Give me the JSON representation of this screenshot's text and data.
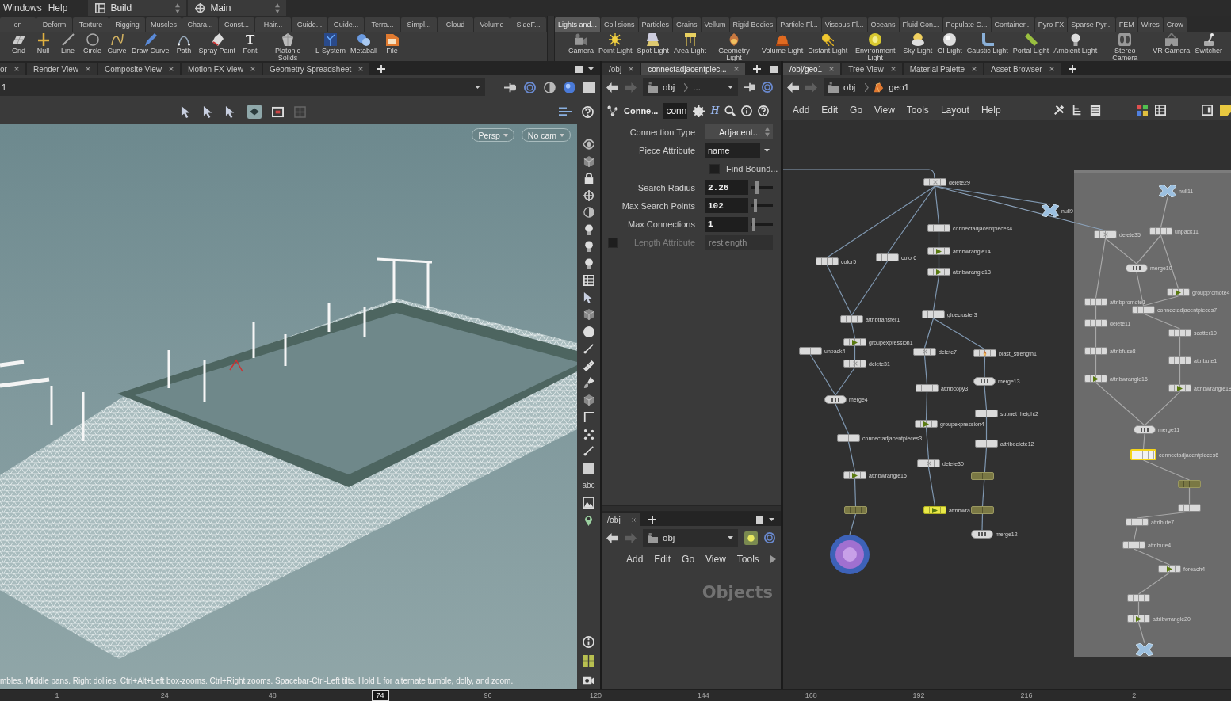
{
  "menubar": {
    "menus": [
      "Windows",
      "Help"
    ],
    "dropdowns": [
      "Build",
      "Main"
    ]
  },
  "shelves": [
    {
      "tabs": [
        {
          "label": "on",
          "selected": false
        },
        {
          "label": "Deform",
          "selected": false
        },
        {
          "label": "Texture",
          "selected": false
        },
        {
          "label": "Rigging",
          "selected": false
        },
        {
          "label": "Muscles",
          "selected": false
        },
        {
          "label": "Chara...",
          "selected": false
        },
        {
          "label": "Const...",
          "selected": false
        },
        {
          "label": "Hair...",
          "selected": false
        },
        {
          "label": "Guide...",
          "selected": false
        },
        {
          "label": "Guide...",
          "selected": false
        },
        {
          "label": "Terra...",
          "selected": false
        },
        {
          "label": "Simpl...",
          "selected": false
        },
        {
          "label": "Cloud",
          "selected": false
        },
        {
          "label": "Volume",
          "selected": false
        },
        {
          "label": "SideF...",
          "selected": false
        }
      ],
      "tools": [
        {
          "label": "Grid"
        },
        {
          "label": "Null"
        },
        {
          "label": "Line"
        },
        {
          "label": "Circle"
        },
        {
          "label": "Curve"
        },
        {
          "label": "Draw Curve"
        },
        {
          "label": "Path"
        },
        {
          "label": "Spray Paint"
        },
        {
          "label": "Font",
          "glyph": "T"
        },
        {
          "label": "Platonic Solids"
        },
        {
          "label": "L-System"
        },
        {
          "label": "Metaball"
        },
        {
          "label": "File"
        }
      ]
    },
    {
      "tabs": [
        {
          "label": "Lights and...",
          "selected": true
        },
        {
          "label": "Collisions",
          "selected": false
        },
        {
          "label": "Particles",
          "selected": false
        },
        {
          "label": "Grains",
          "selected": false
        },
        {
          "label": "Vellum",
          "selected": false
        },
        {
          "label": "Rigid Bodies",
          "selected": false
        },
        {
          "label": "Particle Fl...",
          "selected": false
        },
        {
          "label": "Viscous Fl...",
          "selected": false
        },
        {
          "label": "Oceans",
          "selected": false
        },
        {
          "label": "Fluid Con...",
          "selected": false
        },
        {
          "label": "Populate C...",
          "selected": false
        },
        {
          "label": "Container...",
          "selected": false
        },
        {
          "label": "Pyro FX",
          "selected": false
        },
        {
          "label": "Sparse Pyr...",
          "selected": false
        },
        {
          "label": "FEM",
          "selected": false
        },
        {
          "label": "Wires",
          "selected": false
        },
        {
          "label": "Crow",
          "selected": false
        }
      ],
      "tools": [
        {
          "label": "Camera"
        },
        {
          "label": "Point Light"
        },
        {
          "label": "Spot Light"
        },
        {
          "label": "Area Light"
        },
        {
          "label": "Geometry Light"
        },
        {
          "label": "Volume Light"
        },
        {
          "label": "Distant Light"
        },
        {
          "label": "Environment Light"
        },
        {
          "label": "Sky Light"
        },
        {
          "label": "GI Light"
        },
        {
          "label": "Caustic Light"
        },
        {
          "label": "Portal Light"
        },
        {
          "label": "Ambient Light"
        },
        {
          "label": "Stereo Camera"
        },
        {
          "label": "VR Camera"
        },
        {
          "label": "Switcher"
        }
      ]
    }
  ],
  "pane_tabs": [
    {
      "tabs": [
        {
          "label": "or",
          "selected": false
        },
        {
          "label": "Render View",
          "selected": false
        },
        {
          "label": "Composite View",
          "selected": false
        },
        {
          "label": "Motion FX View",
          "selected": false
        },
        {
          "label": "Geometry Spreadsheet",
          "selected": false
        }
      ]
    },
    {
      "tabs": [
        {
          "label": "/obj",
          "selected": false
        },
        {
          "label": "connectadjacentpiec...",
          "selected": true
        }
      ]
    },
    {
      "tabs": [
        {
          "label": "/obj/geo1",
          "selected": true
        },
        {
          "label": "Tree View",
          "selected": false
        },
        {
          "label": "Material Palette",
          "selected": false
        },
        {
          "label": "Asset Browser",
          "selected": false
        }
      ]
    }
  ],
  "viewport": {
    "path_value": "1",
    "view_menus": [
      "Persp",
      "No cam"
    ],
    "toolbar_label": "abc",
    "status": "mbles. Middle pans. Right dollies. Ctrl+Alt+Left box-zooms. Ctrl+Right zooms. Spacebar-Ctrl-Left tilts. Hold L for alternate tumble, dolly, and zoom."
  },
  "parameters": {
    "path": [
      "obj",
      "..."
    ],
    "node_type": "Conne...",
    "node_name": "conn",
    "asset_glyph": "H",
    "rows": [
      {
        "kind": "menu",
        "label": "Connection Type",
        "value": "Adjacent..."
      },
      {
        "kind": "string-menu",
        "label": "Piece Attribute",
        "value": "name"
      },
      {
        "kind": "toggle",
        "label": "Find Bound...",
        "checked": false
      },
      {
        "kind": "slider",
        "label": "Search Radius",
        "value": "2.26",
        "level": 0.2
      },
      {
        "kind": "slider",
        "label": "Max Search Points",
        "value": "102",
        "level": 0.12
      },
      {
        "kind": "slider",
        "label": "Max Connections",
        "value": "1",
        "level": 0.03
      },
      {
        "kind": "toggle-string",
        "label": "Length Attribute",
        "checked": false,
        "disabled": true,
        "value": "restlength"
      }
    ]
  },
  "lower_pane": {
    "tabs": [
      {
        "label": "/obj",
        "selected": true
      }
    ],
    "path": [
      "obj"
    ],
    "menus": [
      "Add",
      "Edit",
      "Go",
      "View",
      "Tools"
    ],
    "context_label": "Objects"
  },
  "network": {
    "path": [
      "obj",
      "geo1"
    ],
    "menus": [
      "Add",
      "Edit",
      "Go",
      "View",
      "Tools",
      "Layout",
      "Help"
    ],
    "nodes": [
      {
        "label": "delete29",
        "kind": "delete",
        "selected": false,
        "bypassed": false,
        "templated": false
      },
      {
        "label": "null9",
        "kind": "null",
        "selected": false,
        "bypassed": false,
        "templated": false
      },
      {
        "label": "connectadjacentpieces4",
        "kind": "sop",
        "selected": false,
        "bypassed": false,
        "templated": false
      },
      {
        "label": "attribwrangle14",
        "kind": "wrangle",
        "selected": false,
        "bypassed": false,
        "templated": false
      },
      {
        "label": "attribwrangle13",
        "kind": "wrangle",
        "selected": false,
        "bypassed": false,
        "templated": false
      },
      {
        "label": "color5",
        "kind": "sop",
        "selected": false,
        "bypassed": false,
        "templated": false
      },
      {
        "label": "color6",
        "kind": "sop",
        "selected": false,
        "bypassed": false,
        "templated": false
      },
      {
        "label": "attribtransfer1",
        "kind": "sop",
        "selected": false,
        "bypassed": false,
        "templated": false
      },
      {
        "label": "gluecluster3",
        "kind": "sop",
        "selected": false,
        "bypassed": false,
        "templated": false
      },
      {
        "label": "groupexpression1",
        "kind": "wrangle",
        "selected": false,
        "bypassed": false,
        "templated": false
      },
      {
        "label": "unpack4",
        "kind": "sop",
        "selected": false,
        "bypassed": false,
        "templated": false
      },
      {
        "label": "delete31",
        "kind": "delete",
        "selected": false,
        "bypassed": false,
        "templated": false
      },
      {
        "label": "delete7",
        "kind": "delete",
        "selected": false,
        "bypassed": false,
        "templated": false
      },
      {
        "label": "blast_strength1",
        "kind": "blast",
        "selected": false,
        "bypassed": false,
        "templated": false
      },
      {
        "label": "merge4",
        "kind": "merge",
        "selected": false,
        "bypassed": false,
        "templated": false
      },
      {
        "label": "attribcopy3",
        "kind": "sop",
        "selected": false,
        "bypassed": false,
        "templated": false
      },
      {
        "label": "merge13",
        "kind": "merge",
        "selected": false,
        "bypassed": false,
        "templated": false
      },
      {
        "label": "subnet_height2",
        "kind": "sop",
        "selected": false,
        "bypassed": false,
        "templated": false
      },
      {
        "label": "groupexpression4",
        "kind": "wrangle",
        "selected": false,
        "bypassed": false,
        "templated": false
      },
      {
        "label": "connectadjacentpieces3",
        "kind": "sop",
        "selected": false,
        "bypassed": false,
        "templated": false
      },
      {
        "label": "attribdelete12",
        "kind": "sop",
        "selected": false,
        "bypassed": false,
        "templated": false
      },
      {
        "label": "delete30",
        "kind": "delete",
        "selected": false,
        "bypassed": false,
        "templated": false
      },
      {
        "label": "attribwrangle15",
        "kind": "wrangle",
        "selected": false,
        "bypassed": false,
        "templated": false
      },
      {
        "kind": "sop",
        "selected": false,
        "bypassed": false,
        "templated": true
      },
      {
        "kind": "sop",
        "selected": false,
        "bypassed": false,
        "templated": true
      },
      {
        "label": "attribwra",
        "kind": "wrangle",
        "selected": false,
        "bypassed": true,
        "templated": false
      },
      {
        "kind": "sop",
        "selected": false,
        "bypassed": false,
        "templated": true
      },
      {
        "label": "merge12",
        "kind": "merge",
        "selected": false,
        "bypassed": false,
        "templated": false
      },
      {
        "kind": "object",
        "selected": false,
        "bypassed": false,
        "templated": false
      }
    ],
    "network_box": {
      "nodes": [
        {
          "label": "null11",
          "kind": "null",
          "selected": false,
          "bypassed": false,
          "templated": false
        },
        {
          "label": "delete35",
          "kind": "delete",
          "selected": false,
          "bypassed": false,
          "templated": false
        },
        {
          "label": "unpack11",
          "kind": "sop",
          "selected": false,
          "bypassed": false,
          "templated": false
        },
        {
          "label": "merge10",
          "kind": "merge",
          "selected": false,
          "bypassed": false,
          "templated": false
        },
        {
          "label": "grouppromote4",
          "kind": "wrangle",
          "selected": false,
          "bypassed": false,
          "templated": false
        },
        {
          "label": "attribpromote1",
          "kind": "sop",
          "selected": false,
          "bypassed": false,
          "templated": false
        },
        {
          "label": "connectadjacentpieces7",
          "kind": "sop",
          "selected": false,
          "bypassed": false,
          "templated": false
        },
        {
          "label": "delete11",
          "kind": "sop",
          "selected": false,
          "bypassed": false,
          "templated": false
        },
        {
          "label": "scatter10",
          "kind": "sop",
          "selected": false,
          "bypassed": false,
          "templated": false
        },
        {
          "label": "attribfuse8",
          "kind": "sop",
          "selected": false,
          "bypassed": false,
          "templated": false
        },
        {
          "label": "attribute1",
          "kind": "sop",
          "selected": false,
          "bypassed": false,
          "templated": false
        },
        {
          "label": "attribwrangle16",
          "kind": "wrangle",
          "selected": false,
          "bypassed": false,
          "templated": false
        },
        {
          "label": "attribwrangle18",
          "kind": "wrangle",
          "selected": false,
          "bypassed": false,
          "templated": false
        },
        {
          "label": "merge11",
          "kind": "merge",
          "selected": false,
          "bypassed": false,
          "templated": false
        },
        {
          "label": "connectadjacentpieces6",
          "kind": "sop",
          "selected": true,
          "bypassed": false,
          "templated": false
        },
        {
          "kind": "sop",
          "selected": false,
          "bypassed": false,
          "templated": true
        },
        {
          "kind": "sop",
          "selected": false,
          "bypassed": false,
          "templated": false
        },
        {
          "label": "attribute7",
          "kind": "sop",
          "selected": false,
          "bypassed": false,
          "templated": false
        },
        {
          "label": "attribute4",
          "kind": "sop",
          "selected": false,
          "bypassed": false,
          "templated": false
        },
        {
          "label": "foreach4",
          "kind": "wrangle",
          "selected": false,
          "bypassed": false,
          "templated": false
        },
        {
          "kind": "sop",
          "selected": false,
          "bypassed": false,
          "templated": false
        },
        {
          "label": "attribwrangle20",
          "kind": "wrangle",
          "selected": false,
          "bypassed": false,
          "templated": false
        },
        {
          "kind": "null",
          "selected": false,
          "bypassed": false,
          "templated": false
        }
      ]
    }
  },
  "timeline": {
    "frames": [
      {
        "label": "1",
        "selected": false
      },
      {
        "label": "24",
        "selected": false
      },
      {
        "label": "48",
        "selected": false
      },
      {
        "label": "74",
        "selected": true
      },
      {
        "label": "96",
        "selected": false
      },
      {
        "label": "120",
        "selected": false
      },
      {
        "label": "144",
        "selected": false
      },
      {
        "label": "168",
        "selected": false
      },
      {
        "label": "192",
        "selected": false
      },
      {
        "label": "216",
        "selected": false
      },
      {
        "label": "2",
        "selected": false
      }
    ]
  }
}
